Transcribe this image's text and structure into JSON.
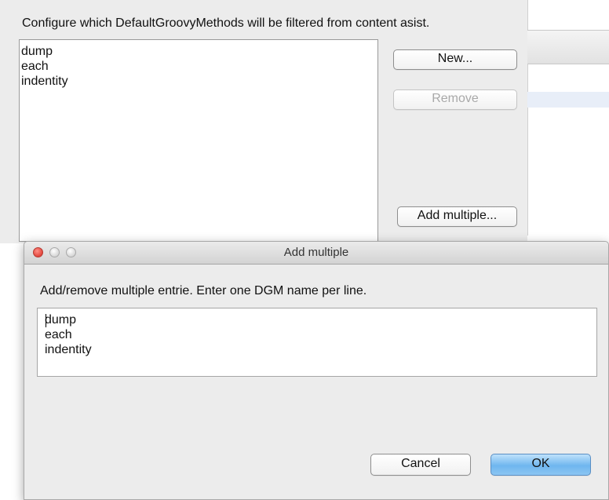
{
  "preferences": {
    "description": "Configure which DefaultGroovyMethods will be filtered from content asist.",
    "filter_list": [
      "dump",
      "each",
      "indentity"
    ],
    "buttons": {
      "new": "New...",
      "remove": "Remove",
      "add_multiple": "Add multiple..."
    }
  },
  "dialog": {
    "title": "Add multiple",
    "instruction": "Add/remove multiple entrie.  Enter one DGM name per line.",
    "entries": [
      "dump",
      "each",
      "indentity"
    ],
    "buttons": {
      "cancel": "Cancel",
      "ok": "OK"
    },
    "window_controls": [
      "close-icon",
      "minimize-icon",
      "zoom-icon"
    ]
  },
  "colors": {
    "default_button": "#6fb6ef",
    "close_light": "#e2463d"
  }
}
